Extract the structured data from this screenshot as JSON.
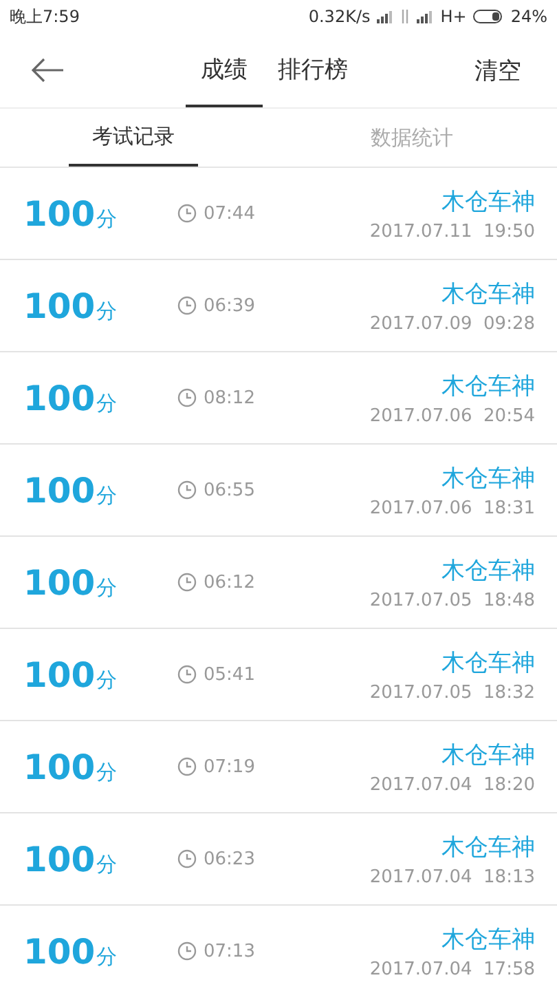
{
  "status_bar": {
    "time": "晚上7:59",
    "speed": "0.32K/s",
    "network": "H+",
    "battery": "24%"
  },
  "header": {
    "tabs": [
      {
        "label": "成绩",
        "selected": true
      },
      {
        "label": "排行榜",
        "selected": false
      }
    ],
    "action": "清空"
  },
  "subtabs": [
    {
      "label": "考试记录",
      "selected": true
    },
    {
      "label": "数据统计",
      "selected": false
    }
  ],
  "records": [
    {
      "score": "100",
      "unit": "分",
      "duration": "07:44",
      "name": "木仓车神",
      "date": "2017.07.11  19:50"
    },
    {
      "score": "100",
      "unit": "分",
      "duration": "06:39",
      "name": "木仓车神",
      "date": "2017.07.09  09:28"
    },
    {
      "score": "100",
      "unit": "分",
      "duration": "08:12",
      "name": "木仓车神",
      "date": "2017.07.06  20:54"
    },
    {
      "score": "100",
      "unit": "分",
      "duration": "06:55",
      "name": "木仓车神",
      "date": "2017.07.06  18:31"
    },
    {
      "score": "100",
      "unit": "分",
      "duration": "06:12",
      "name": "木仓车神",
      "date": "2017.07.05  18:48"
    },
    {
      "score": "100",
      "unit": "分",
      "duration": "05:41",
      "name": "木仓车神",
      "date": "2017.07.05  18:32"
    },
    {
      "score": "100",
      "unit": "分",
      "duration": "07:19",
      "name": "木仓车神",
      "date": "2017.07.04  18:20"
    },
    {
      "score": "100",
      "unit": "分",
      "duration": "06:23",
      "name": "木仓车神",
      "date": "2017.07.04  18:13"
    },
    {
      "score": "100",
      "unit": "分",
      "duration": "07:13",
      "name": "木仓车神",
      "date": "2017.07.04  17:58"
    }
  ]
}
